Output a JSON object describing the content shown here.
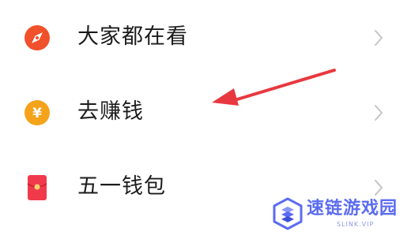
{
  "menu": {
    "items": [
      {
        "label": "大家都在看",
        "icon": "compass-icon",
        "icon_color": "#f0502a"
      },
      {
        "label": "去赚钱",
        "icon": "yen-coin-icon",
        "icon_color": "#f5a31a",
        "icon_glyph": "¥"
      },
      {
        "label": "五一钱包",
        "icon": "red-envelope-icon",
        "icon_color": "#f03a4c"
      }
    ],
    "chevron_color": "#c4c4c4"
  },
  "annotation": {
    "arrow_color": "#e8383f"
  },
  "watermark": {
    "title": "速链游戏园",
    "subtitle": "SLINK.VIP",
    "color": "#5b6cf2"
  }
}
